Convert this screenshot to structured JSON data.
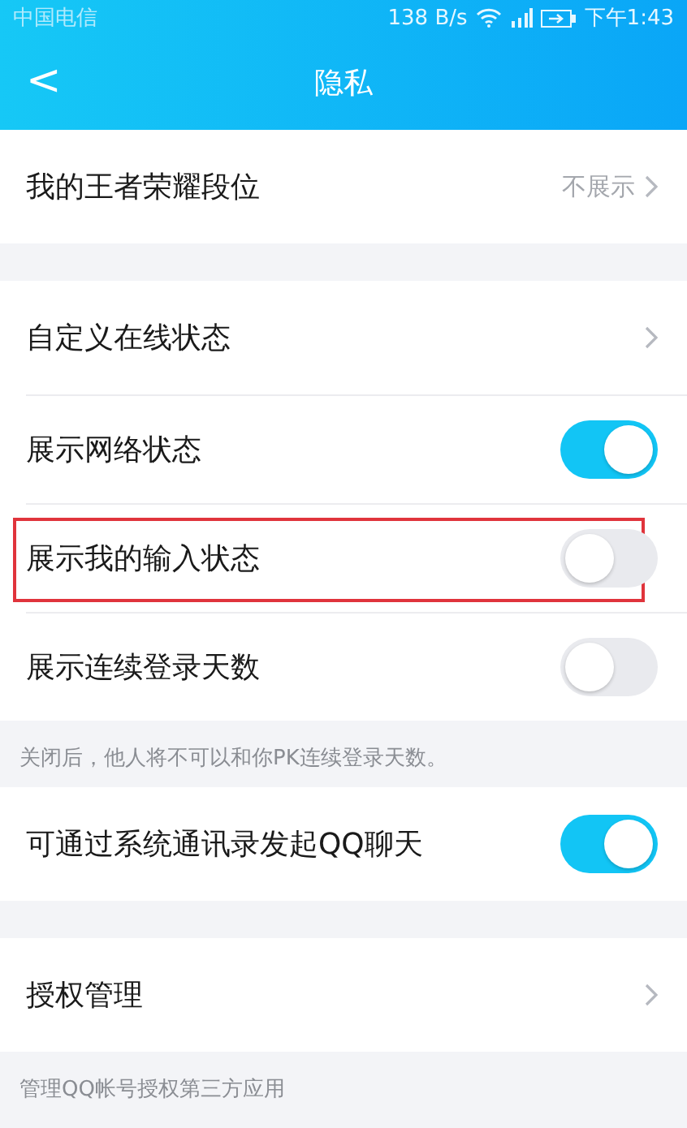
{
  "status_bar": {
    "carrier": "中国电信",
    "speed": "138 B/s",
    "time": "下午1:43"
  },
  "header": {
    "back": "<",
    "title": "隐私"
  },
  "sections": [
    {
      "rows": [
        {
          "kind": "nav",
          "label": "我的王者荣耀段位",
          "value": "不展示",
          "highlighted": false
        }
      ]
    },
    {
      "rows": [
        {
          "kind": "nav",
          "label": "自定义在线状态",
          "highlighted": false
        },
        {
          "kind": "toggle",
          "label": "展示网络状态",
          "on": true,
          "highlighted": false
        },
        {
          "kind": "toggle",
          "label": "展示我的输入状态",
          "on": false,
          "highlighted": true
        },
        {
          "kind": "toggle",
          "label": "展示连续登录天数",
          "on": false,
          "highlighted": false
        }
      ],
      "note": "关闭后，他人将不可以和你PK连续登录天数。"
    },
    {
      "rows": [
        {
          "kind": "toggle",
          "label": "可通过系统通讯录发起QQ聊天",
          "on": true,
          "highlighted": false
        }
      ]
    },
    {
      "rows": [
        {
          "kind": "nav",
          "label": "授权管理",
          "highlighted": false
        }
      ],
      "note": "管理QQ帐号授权第三方应用"
    }
  ]
}
